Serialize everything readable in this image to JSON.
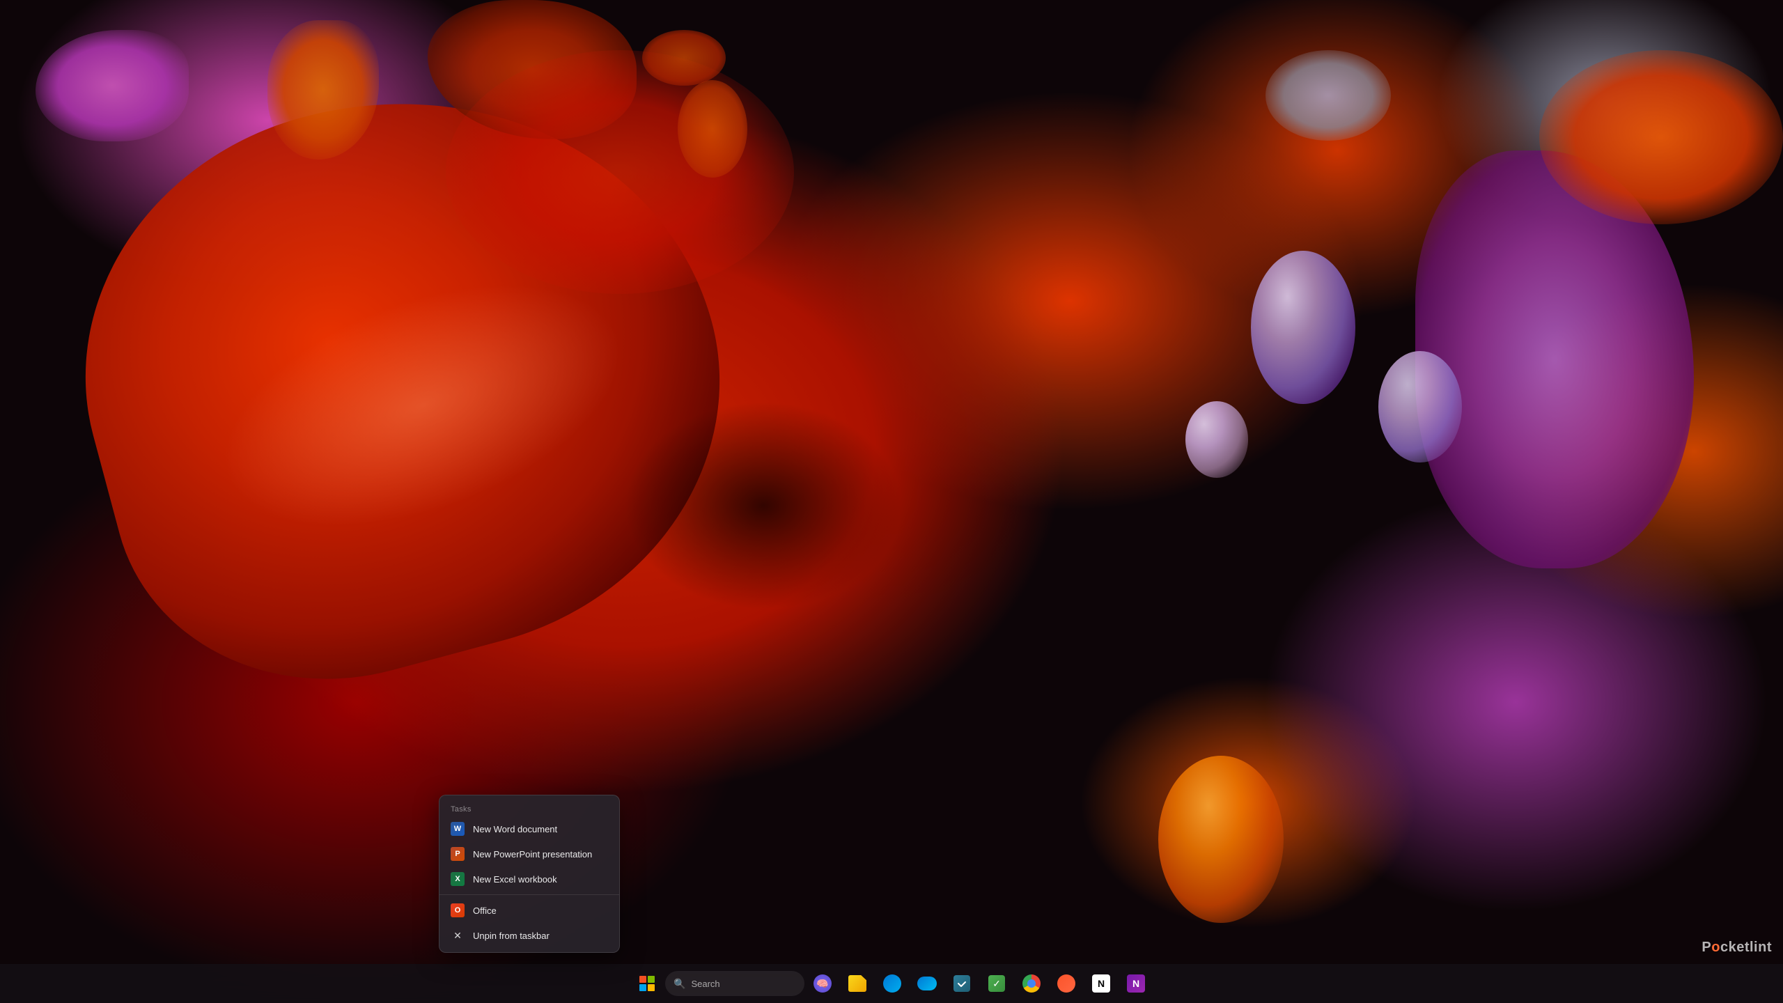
{
  "desktop": {
    "watermark": "Pocketlint"
  },
  "taskbar": {
    "search_placeholder": "Search",
    "items": [
      {
        "name": "start",
        "label": "Start"
      },
      {
        "name": "search",
        "label": "Search"
      },
      {
        "name": "brain",
        "label": "AI"
      },
      {
        "name": "file-explorer",
        "label": "File Explorer"
      },
      {
        "name": "edge",
        "label": "Microsoft Edge"
      },
      {
        "name": "onedrive",
        "label": "OneDrive"
      },
      {
        "name": "todo",
        "label": "Microsoft To Do"
      },
      {
        "name": "tasks",
        "label": "Tasks"
      },
      {
        "name": "chrome",
        "label": "Google Chrome"
      },
      {
        "name": "brave",
        "label": "Brave"
      },
      {
        "name": "notion",
        "label": "Notion"
      },
      {
        "name": "onenote",
        "label": "OneNote"
      }
    ]
  },
  "context_menu": {
    "section_label": "Tasks",
    "items": [
      {
        "id": "new-word",
        "label": "New Word document",
        "icon": "word"
      },
      {
        "id": "new-ppt",
        "label": "New PowerPoint presentation",
        "icon": "powerpoint"
      },
      {
        "id": "new-excel",
        "label": "New Excel workbook",
        "icon": "excel"
      },
      {
        "id": "office",
        "label": "Office",
        "icon": "office"
      },
      {
        "id": "unpin",
        "label": "Unpin from taskbar",
        "icon": "unpin"
      }
    ]
  }
}
